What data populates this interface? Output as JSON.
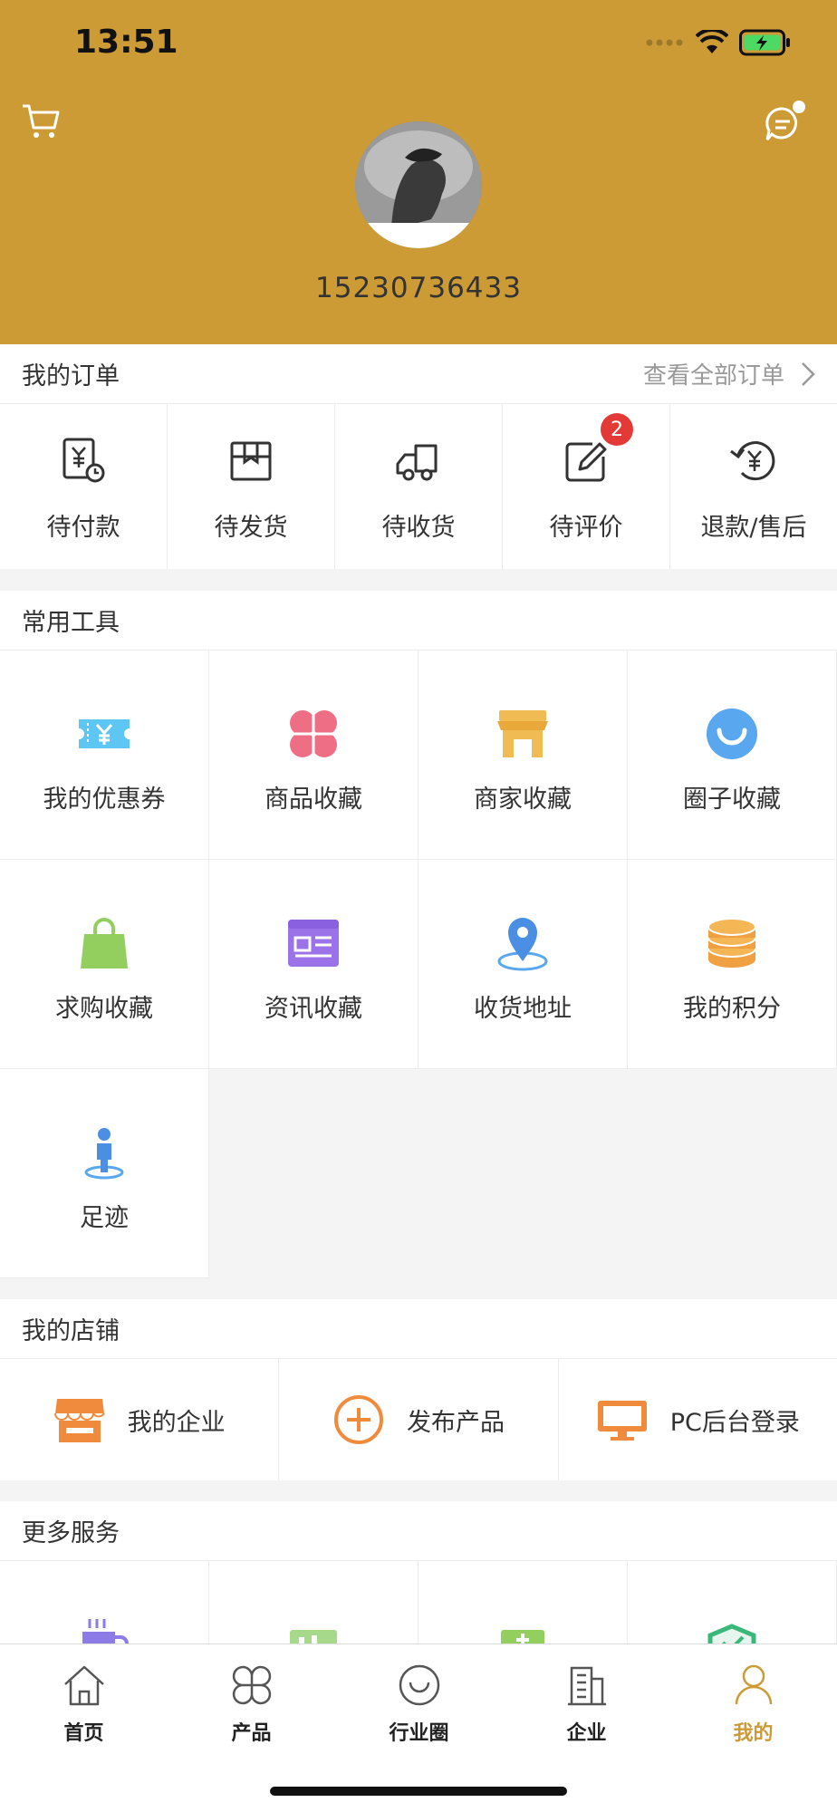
{
  "status": {
    "time": "13:51"
  },
  "header": {
    "phone": "15230736433",
    "accent_color": "#cd9b35",
    "cart_icon": "cart-icon",
    "message_icon": "message-icon"
  },
  "orders": {
    "title": "我的订单",
    "view_all": "查看全部订单",
    "items": [
      {
        "label": "待付款",
        "icon": "pending-payment-icon"
      },
      {
        "label": "待发货",
        "icon": "pending-shipment-icon"
      },
      {
        "label": "待收货",
        "icon": "pending-receipt-icon"
      },
      {
        "label": "待评价",
        "icon": "pending-review-icon",
        "badge": "2"
      },
      {
        "label": "退款/售后",
        "icon": "refund-icon"
      }
    ]
  },
  "tools": {
    "title": "常用工具",
    "items": [
      {
        "label": "我的优惠券",
        "icon": "coupon-icon"
      },
      {
        "label": "商品收藏",
        "icon": "product-favorite-icon"
      },
      {
        "label": "商家收藏",
        "icon": "store-favorite-icon"
      },
      {
        "label": "圈子收藏",
        "icon": "circle-favorite-icon"
      },
      {
        "label": "求购收藏",
        "icon": "shopping-bag-icon"
      },
      {
        "label": "资讯收藏",
        "icon": "news-icon"
      },
      {
        "label": "收货地址",
        "icon": "location-icon"
      },
      {
        "label": "我的积分",
        "icon": "points-icon"
      },
      {
        "label": "足迹",
        "icon": "footprint-icon"
      }
    ]
  },
  "shop": {
    "title": "我的店铺",
    "items": [
      {
        "label": "我的企业",
        "icon": "enterprise-icon"
      },
      {
        "label": "发布产品",
        "icon": "publish-icon"
      },
      {
        "label": "PC后台登录",
        "icon": "desktop-icon"
      }
    ]
  },
  "more": {
    "title": "更多服务"
  },
  "tabbar": {
    "items": [
      {
        "label": "首页",
        "icon": "home-icon"
      },
      {
        "label": "产品",
        "icon": "products-icon"
      },
      {
        "label": "行业圈",
        "icon": "industry-circle-icon"
      },
      {
        "label": "企业",
        "icon": "company-icon"
      },
      {
        "label": "我的",
        "icon": "profile-icon",
        "active": true
      }
    ]
  }
}
